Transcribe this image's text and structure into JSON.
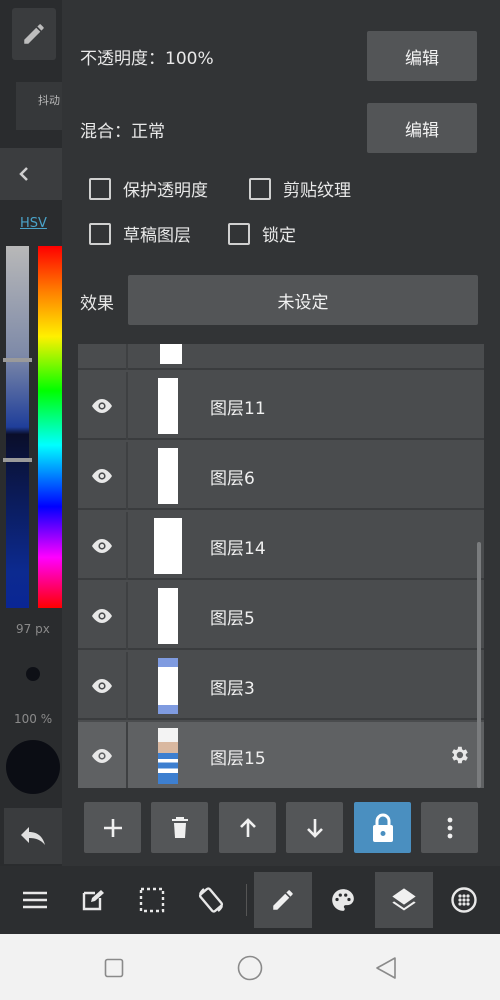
{
  "left_panel": {
    "brush_name": "抖动",
    "color_mode_label": "HSV",
    "brush_size_label": "97 px",
    "brush_opacity_label": "100 %"
  },
  "layer_properties": {
    "opacity_label": "不透明度：100%",
    "blend_label": "混合：正常",
    "edit_label": "编辑",
    "checkboxes": [
      {
        "label": "保护透明度",
        "checked": false
      },
      {
        "label": "剪贴纹理",
        "checked": false
      },
      {
        "label": "草稿图层",
        "checked": false
      },
      {
        "label": "锁定",
        "checked": false
      }
    ],
    "effect_label": "效果",
    "effect_value": "未设定"
  },
  "layers": [
    {
      "name": "图层11",
      "selected": false
    },
    {
      "name": "图层6",
      "selected": false
    },
    {
      "name": "图层14",
      "selected": false
    },
    {
      "name": "图层5",
      "selected": false
    },
    {
      "name": "图层3",
      "selected": false
    },
    {
      "name": "图层15",
      "selected": true
    }
  ],
  "layer_actions": [
    "add-icon",
    "trash-icon",
    "arrow-up-icon",
    "arrow-down-icon",
    "lock-icon",
    "more-vertical-icon"
  ],
  "toolbar": [
    "menu-icon",
    "edit-icon",
    "select-icon",
    "rotate-icon",
    "pencil-icon",
    "palette-icon",
    "layers-icon",
    "material-icon"
  ],
  "colors": {
    "accent_lock": "#4a8fc0",
    "panel_bg": "#323436",
    "selected_layer": "#5f6163"
  }
}
